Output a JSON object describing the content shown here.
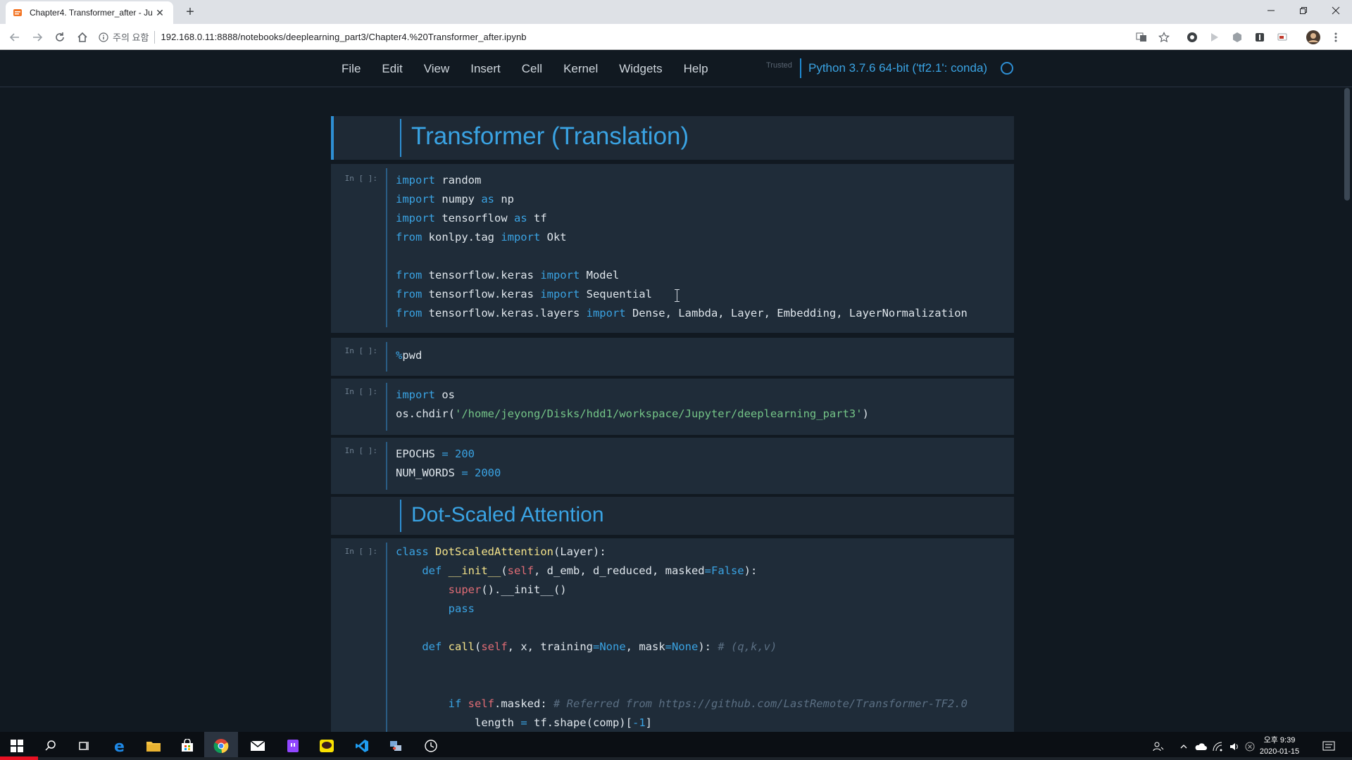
{
  "browser": {
    "tab_title": "Chapter4. Transformer_after - Ju",
    "new_tab_label": "+",
    "security_label": "주의 요함",
    "url": "192.168.0.11:8888/notebooks/deeplearning_part3/Chapter4.%20Transformer_after.ipynb"
  },
  "jupyter": {
    "menu": [
      "File",
      "Edit",
      "View",
      "Insert",
      "Cell",
      "Kernel",
      "Widgets",
      "Help"
    ],
    "trusted_label": "Trusted",
    "kernel_name": "Python 3.7.6 64-bit ('tf2.1': conda)"
  },
  "notebook": {
    "heading1": "Transformer (Translation)",
    "heading2": "Dot-Scaled Attention",
    "prompt": "In [ ]:",
    "cell1": [
      "import random",
      "import numpy as np",
      "import tensorflow as tf",
      "from konlpy.tag import Okt",
      "",
      "from tensorflow.keras import Model",
      "from tensorflow.keras import Sequential",
      "from tensorflow.keras.layers import Dense, Lambda, Layer, Embedding, LayerNormalization"
    ],
    "cell2": [
      "%pwd"
    ],
    "cell3": [
      "import os",
      "os.chdir('/home/jeyong/Disks/hdd1/workspace/Jupyter/deeplearning_part3')"
    ],
    "cell4": [
      "EPOCHS = 200",
      "NUM_WORDS = 2000"
    ],
    "cell5": [
      "class DotScaledAttention(Layer):",
      "    def __init__(self, d_emb, d_reduced, masked=False):",
      "        super().__init__()",
      "        pass",
      "",
      "    def call(self, x, training=None, mask=None): # (q,k,v)",
      "",
      "",
      "        if self.masked: # Referred from https://github.com/LastRemote/Transformer-TF2.0",
      "            length = tf.shape(comp)[-1]"
    ]
  },
  "taskbar": {
    "clock_time": "오후 9:39",
    "clock_date": "2020-01-15"
  },
  "colors": {
    "background": "#111921",
    "cell_bg": "#1f2c39",
    "accent": "#3aa3e3",
    "string": "#74c487",
    "classname": "#f3e28a",
    "self": "#e06c75"
  }
}
